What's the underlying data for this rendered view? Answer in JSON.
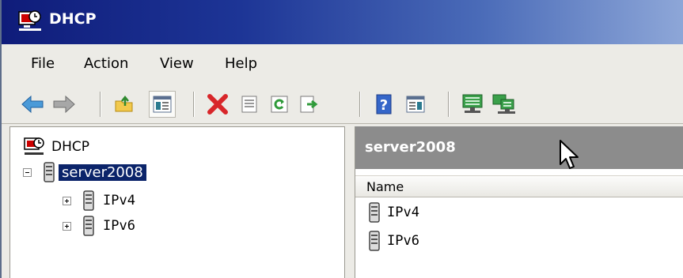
{
  "window": {
    "title": "DHCP"
  },
  "menu": {
    "file": "File",
    "action": "Action",
    "view": "View",
    "help": "Help"
  },
  "toolbar": {
    "buttons": [
      "back-arrow-icon",
      "forward-arrow-icon",
      "up-folder-icon",
      "show-hide-tree-icon",
      "delete-icon",
      "properties-icon",
      "refresh-icon",
      "export-list-icon",
      "help-icon",
      "show-hide-action-pane-icon",
      "authorize-server-icon",
      "manage-servers-icon"
    ]
  },
  "tree": {
    "root": "DHCP",
    "server": "server2008",
    "children": [
      "IPv4",
      "IPv6"
    ]
  },
  "details": {
    "header": "server2008",
    "column_name": "Name",
    "items": [
      "IPv4",
      "IPv6"
    ]
  },
  "colors": {
    "title_dark": "#0f1c7a",
    "selection": "#0b246a",
    "header_gray": "#8c8c8c"
  }
}
